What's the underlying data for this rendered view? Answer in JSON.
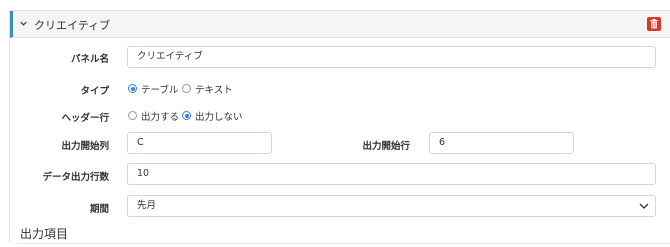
{
  "panel": {
    "title": "クリエイティブ",
    "icons": {
      "collapse": "chevron-down-icon",
      "delete": "trash-icon"
    },
    "delete_color": "#d9392c"
  },
  "form": {
    "panel_name": {
      "label": "パネル名",
      "value": "クリエイティブ"
    },
    "type": {
      "label": "タイプ",
      "options": [
        "テーブル",
        "テキスト"
      ],
      "selected": "テーブル"
    },
    "header_row": {
      "label": "ヘッダー行",
      "options": [
        "出力する",
        "出力しない"
      ],
      "selected": "出力しない"
    },
    "start_column": {
      "label": "出力開始列",
      "value": "C"
    },
    "start_row": {
      "label": "出力開始行",
      "value": "6"
    },
    "data_rows": {
      "label": "データ出力行数",
      "value": "10"
    },
    "period": {
      "label": "期間",
      "value": "先月"
    }
  },
  "output_section": {
    "title": "出力項目"
  },
  "colors": {
    "accent": "#3c8dbc",
    "radio": "#2f80ed"
  }
}
